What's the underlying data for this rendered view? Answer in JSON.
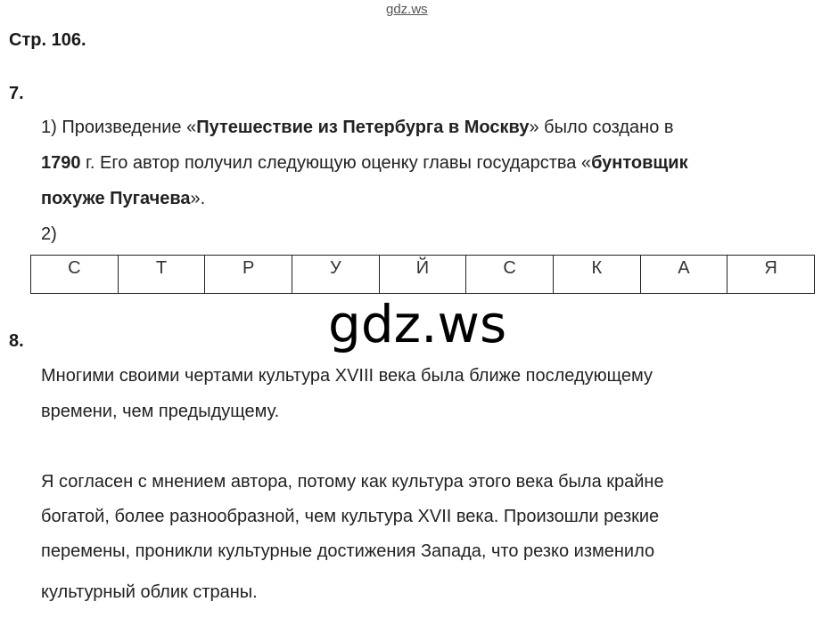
{
  "watermark_top": "gdz.ws",
  "watermark_center": "gdz.ws",
  "page_title": "Стр. 106.",
  "task7": {
    "number": "7.",
    "p1": {
      "a": "1) Произведение «",
      "title": "Путешествие из Петербурга в Москву",
      "b": "» было создано в"
    },
    "p2": {
      "year": "1790",
      "a": " г. Его автор получил следующую оценку главы государства «",
      "quote1": "бунтовщик"
    },
    "p3": {
      "quote2": "похуже Пугачева",
      "a": "»."
    },
    "p4": "2)",
    "letters": [
      "С",
      "Т",
      "Р",
      "У",
      "Й",
      "С",
      "К",
      "А",
      "Я"
    ]
  },
  "task8": {
    "number": "8.",
    "statement_line1": "Многими своими чертами культура XVIII века была ближе последующему",
    "statement_line2": "времени, чем предыдущему.",
    "answer_line1": "Я согласен с мнением автора, потому как культура этого века была крайне",
    "answer_line2": "богатой, более разнообразной, чем культура XVII века. Произошли резкие",
    "answer_line3": "перемены, проникли культурные достижения Запада, что резко изменило",
    "answer_line4": "культурный облик страны."
  }
}
